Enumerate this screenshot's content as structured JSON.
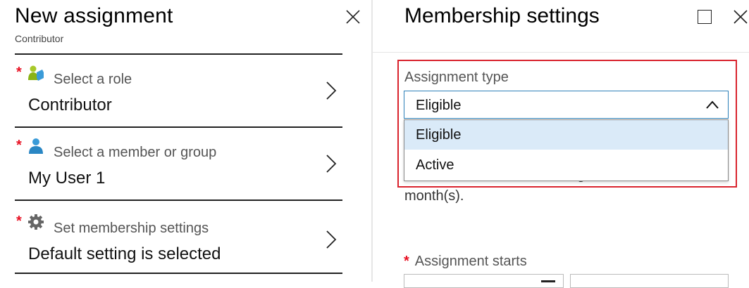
{
  "left_blade": {
    "title": "New assignment",
    "subtitle": "Contributor",
    "items": [
      {
        "label": "Select a role",
        "value": "Contributor",
        "icon": "role-icon"
      },
      {
        "label": "Select a member or group",
        "value": "My User 1",
        "icon": "user-icon"
      },
      {
        "label": "Set membership settings",
        "value": "Default setting is selected",
        "icon": "gear-icon"
      }
    ],
    "required_mark": "*"
  },
  "right_blade": {
    "title": "Membership settings",
    "assignment_type_label": "Assignment type",
    "selected_value": "Eligible",
    "options": [
      "Eligible",
      "Active"
    ],
    "below_text": "month(s).",
    "assignment_starts_label": "Assignment starts"
  },
  "colors": {
    "required": "#e81123",
    "highlight_border": "#d9232d",
    "select_border": "#2b7fb8",
    "option_selected_bg": "#daeaf8"
  }
}
